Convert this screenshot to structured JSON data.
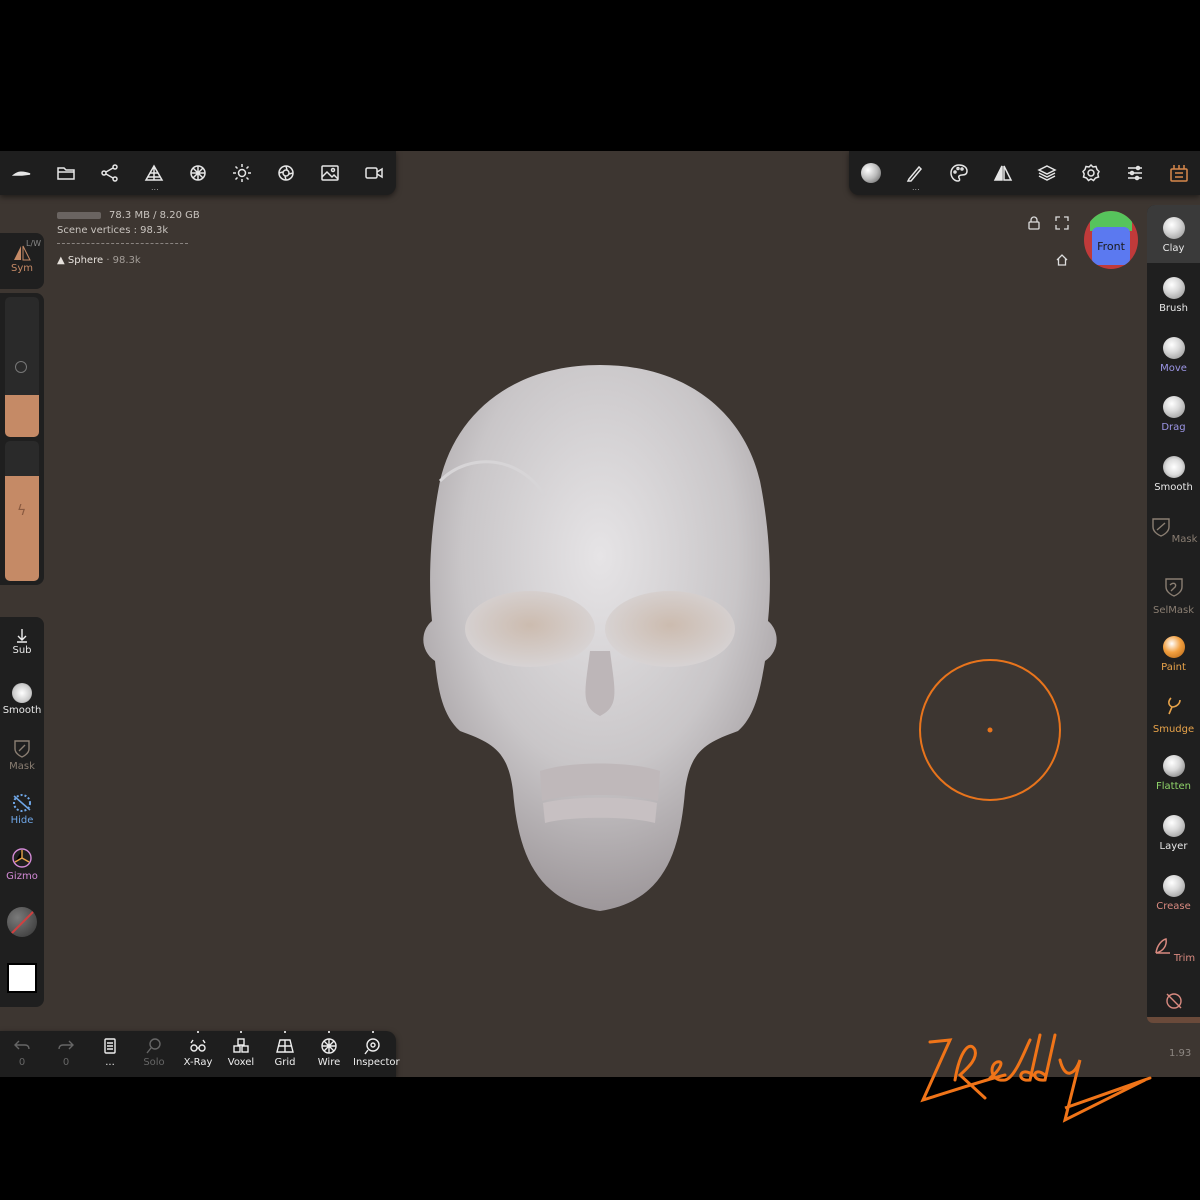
{
  "top_toolbar_left": {
    "items": [
      "home-icon",
      "folder-icon",
      "scene-graph-icon",
      "mesh-icon",
      "material-sphere-icon",
      "light-icon",
      "shading-icon",
      "image-icon",
      "camera-icon"
    ]
  },
  "top_toolbar_right": {
    "items": [
      "material-preview-icon",
      "stroke-icon",
      "palette-icon",
      "symmetry-icon",
      "layers-icon",
      "settings-icon",
      "sliders-icon",
      "interface-icon"
    ]
  },
  "info": {
    "memory": "78.3 MB / 8.20 GB",
    "scene_vertices": "Scene vertices : 98.3k",
    "object_name": "Sphere",
    "object_vertices": "· 98.3k"
  },
  "left_panel": {
    "sym_label": "Sym",
    "sym_badge": "L/W",
    "sub_label": "Sub",
    "smooth_label": "Smooth",
    "mask_label": "Mask",
    "hide_label": "Hide",
    "gizmo_label": "Gizmo",
    "radius_fill": 0.3,
    "intensity_fill": 0.75,
    "accent_color": "#c58a66"
  },
  "orientation_cube": {
    "label": "Front"
  },
  "right_tools": [
    {
      "label": "Clay",
      "color": "#e8e8e8"
    },
    {
      "label": "Brush",
      "color": "#e8e8e8"
    },
    {
      "label": "Move",
      "color": "#9c96e6"
    },
    {
      "label": "Drag",
      "color": "#9c96e6"
    },
    {
      "label": "Smooth",
      "color": "#e8e8e8"
    },
    {
      "label": "Mask",
      "color": "#8a7e72"
    },
    {
      "label": "SelMask",
      "color": "#8a7e72"
    },
    {
      "label": "Paint",
      "color": "#e8a34a"
    },
    {
      "label": "Smudge",
      "color": "#e8a34a"
    },
    {
      "label": "Flatten",
      "color": "#8fd46a"
    },
    {
      "label": "Layer",
      "color": "#e8e8e8"
    },
    {
      "label": "Crease",
      "color": "#d98a80"
    },
    {
      "label": "Trim",
      "color": "#d98a80"
    }
  ],
  "bottom_bar": {
    "undo_count": "0",
    "redo_count": "0",
    "history_label": "...",
    "solo_label": "Solo",
    "xray_label": "X-Ray",
    "voxel_label": "Voxel",
    "grid_label": "Grid",
    "wire_label": "Wire",
    "inspector_label": "Inspector"
  },
  "version": "1.93",
  "signature": "ZReddy"
}
